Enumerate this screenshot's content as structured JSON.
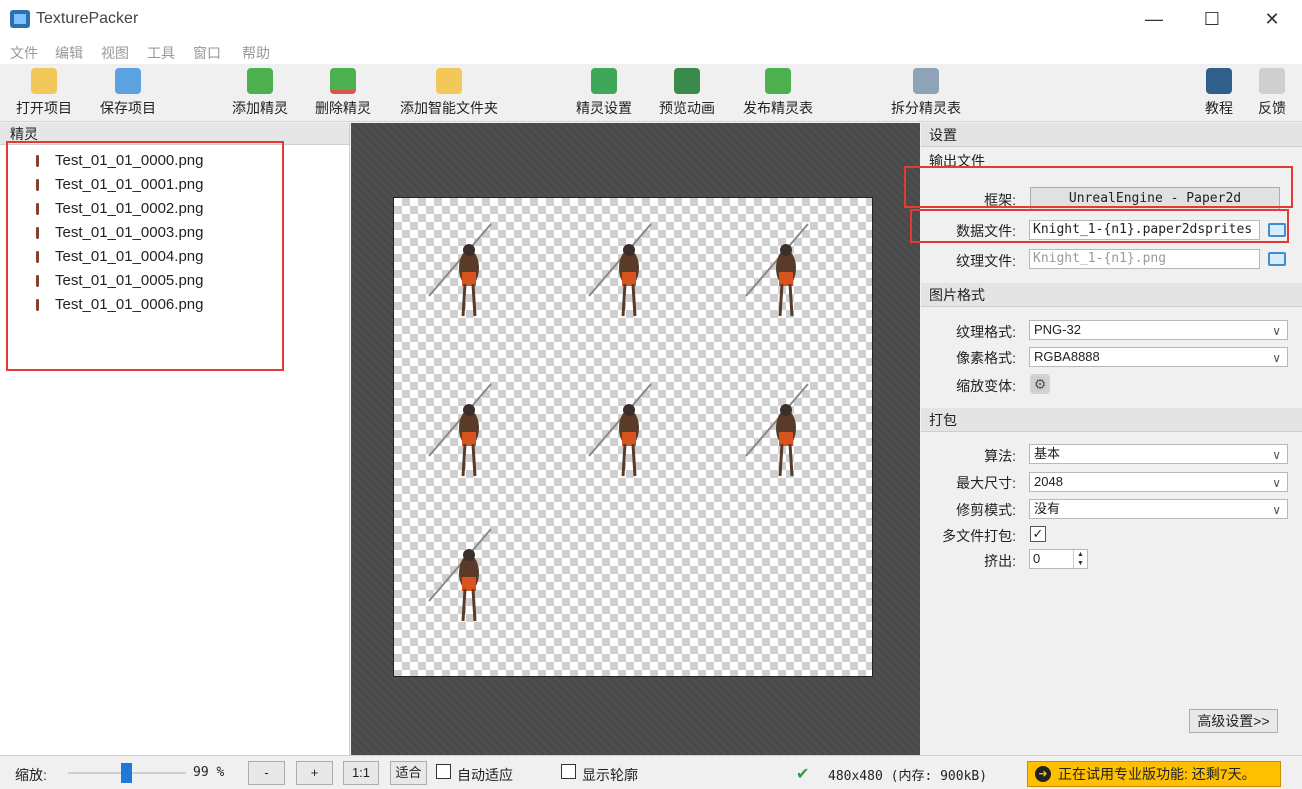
{
  "window": {
    "title": "TexturePacker",
    "minimize_glyph": "—",
    "maximize_glyph": "☐",
    "close_glyph": "✕"
  },
  "menu": [
    "文件",
    "编辑",
    "视图",
    "工具",
    "窗口",
    "帮助"
  ],
  "toolbar": {
    "open_project": "打开项目",
    "save_project": "保存项目",
    "add_sprite": "添加精灵",
    "remove_sprite": "删除精灵",
    "add_smart_folder": "添加智能文件夹",
    "sprite_settings": "精灵设置",
    "preview_animation": "预览动画",
    "publish_sprite_sheet": "发布精灵表",
    "split_sprite_sheet": "拆分精灵表",
    "tutorial": "教程",
    "feedback": "反馈"
  },
  "sprites_panel": {
    "header": "精灵",
    "items": [
      "Test_01_01_0000.png",
      "Test_01_01_0001.png",
      "Test_01_01_0002.png",
      "Test_01_01_0003.png",
      "Test_01_01_0004.png",
      "Test_01_01_0005.png",
      "Test_01_01_0006.png"
    ]
  },
  "settings": {
    "header": "设置",
    "output": {
      "title": "输出文件",
      "framework_label": "框架:",
      "framework_value": "UnrealEngine - Paper2d",
      "data_file_label": "数据文件:",
      "data_file_value": "Knight_1-{n1}.paper2dsprites",
      "texture_file_label": "纹理文件:",
      "texture_file_placeholder": "Knight_1-{n1}.png"
    },
    "image_format": {
      "title": "图片格式",
      "texture_format_label": "纹理格式:",
      "texture_format_value": "PNG-32",
      "pixel_format_label": "像素格式:",
      "pixel_format_value": "RGBA8888",
      "scaling_variants_label": "缩放变体:"
    },
    "packing": {
      "title": "打包",
      "algorithm_label": "算法:",
      "algorithm_value": "基本",
      "max_size_label": "最大尺寸:",
      "max_size_value": "2048",
      "trim_mode_label": "修剪模式:",
      "trim_mode_value": "没有",
      "multipack_label": "多文件打包:",
      "multipack_checked": "✓",
      "extrude_label": "挤出:",
      "extrude_value": "0"
    },
    "advanced_button": "高级设置>>"
  },
  "statusbar": {
    "zoom_label": "缩放:",
    "zoom_value": "99 %",
    "zoom_level": 0.5,
    "minus": "-",
    "plus": "+",
    "one_to_one": "1:1",
    "fit": "适合",
    "auto_fit": "自动适应",
    "show_outlines": "显示轮廓",
    "sheet_info": "480x480 (内存: 900kB)",
    "trial_notice": "正在试用专业版功能: 还剩7天。"
  }
}
